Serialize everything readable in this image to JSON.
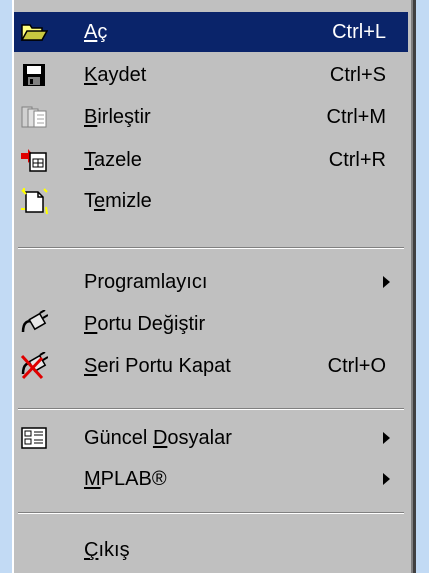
{
  "menu": {
    "items": [
      {
        "pre": "",
        "ul": "A",
        "post": "ç",
        "shortcut": "Ctrl+L",
        "icon": "open-folder-icon",
        "selected": true
      },
      {
        "pre": "",
        "ul": "K",
        "post": "aydet",
        "shortcut": "Ctrl+S",
        "icon": "save-floppy-icon"
      },
      {
        "pre": "",
        "ul": "B",
        "post": "irleştir",
        "shortcut": "Ctrl+M",
        "icon": "merge-pages-icon"
      },
      {
        "pre": "",
        "ul": "T",
        "post": "azele",
        "shortcut": "Ctrl+R",
        "icon": "refresh-document-icon"
      },
      {
        "pre": "T",
        "ul": "e",
        "post": "mizle",
        "shortcut": "",
        "icon": "new-document-icon"
      },
      {
        "pre": "Pro",
        "ul": "g",
        "post": "ramlayıcı",
        "shortcut": "",
        "icon": "",
        "submenu": true
      },
      {
        "pre": "",
        "ul": "P",
        "post": "ortu Değiştir",
        "shortcut": "",
        "icon": "plug-icon"
      },
      {
        "pre": "",
        "ul": "S",
        "post": "eri Portu Kapat",
        "shortcut": "Ctrl+O",
        "icon": "plug-disconnect-icon"
      },
      {
        "pre": "Güncel ",
        "ul": "D",
        "post": "osyalar",
        "shortcut": "",
        "icon": "recent-files-icon",
        "submenu": true
      },
      {
        "pre": "",
        "ul": "M",
        "post": "PLAB®",
        "shortcut": "",
        "icon": "",
        "submenu": true
      },
      {
        "pre": "",
        "ul": "Ç",
        "post": "ıkış",
        "shortcut": "",
        "icon": ""
      }
    ]
  },
  "colors": {
    "selection": "#0a246a",
    "menu_bg": "#c0c0c0",
    "page_bg": "#c2daf4"
  }
}
